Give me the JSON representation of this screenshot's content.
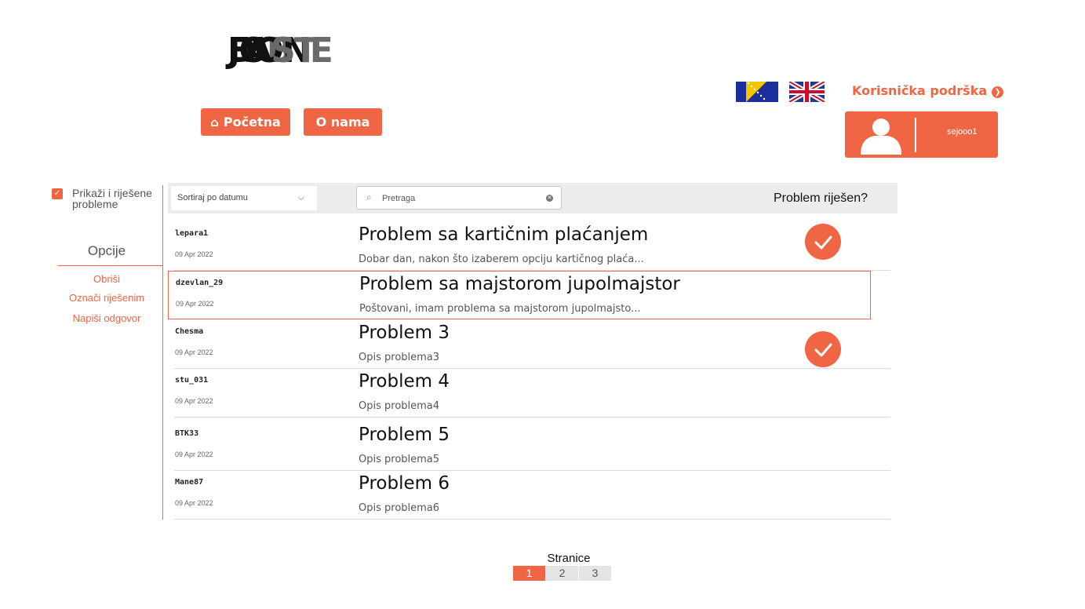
{
  "logo": {
    "lines": [
      [
        "JO",
        "B"
      ],
      [
        "DON",
        "E"
      ],
      [
        "FA",
        "ST"
      ]
    ]
  },
  "nav": {
    "home_label": "Početna",
    "about_label": "O nama"
  },
  "support": {
    "label": "Korisnička podrška"
  },
  "user": {
    "username": "sejooo1"
  },
  "filter": {
    "show_resolved_label": "Prikaži i riješene probleme",
    "checked": true
  },
  "options": {
    "title": "Opcije",
    "delete": "Obriši",
    "mark_resolved": "Označi riješenim",
    "reply": "Napiši odgovor"
  },
  "toolbar": {
    "sort_label": "Sortiraj po datumu",
    "search_placeholder": "Pretraga",
    "resolved_header": "Problem riješen?"
  },
  "problems": [
    {
      "user": "lepara1",
      "date": "09 Apr 2022",
      "title": "Problem sa kartičnim plaćanjem",
      "desc": "Dobar dan, nakon što izaberem opciju kartičnog plaća...",
      "resolved": true,
      "selected": false
    },
    {
      "user": "dzevlan_29",
      "date": "09 Apr 2022",
      "title": "Problem sa majstorom jupolmajstor",
      "desc": "Poštovani, imam problema sa majstorom jupolmajsto...",
      "resolved": false,
      "selected": true
    },
    {
      "user": "Chesma",
      "date": "09 Apr 2022",
      "title": "Problem 3",
      "desc": "Opis problema3",
      "resolved": true,
      "selected": false
    },
    {
      "user": "stu_031",
      "date": "09 Apr 2022",
      "title": "Problem 4",
      "desc": "Opis problema4",
      "resolved": false,
      "selected": false
    },
    {
      "user": "BTK33",
      "date": "09 Apr 2022",
      "title": "Problem 5",
      "desc": "Opis problema5",
      "resolved": false,
      "selected": false
    },
    {
      "user": "Mane87",
      "date": "09 Apr 2022",
      "title": "Problem 6",
      "desc": "Opis problema6",
      "resolved": false,
      "selected": false
    }
  ],
  "pagination": {
    "label": "Stranice",
    "pages": [
      "1",
      "2",
      "3"
    ],
    "active": "1"
  },
  "colors": {
    "accent": "#f06543"
  }
}
